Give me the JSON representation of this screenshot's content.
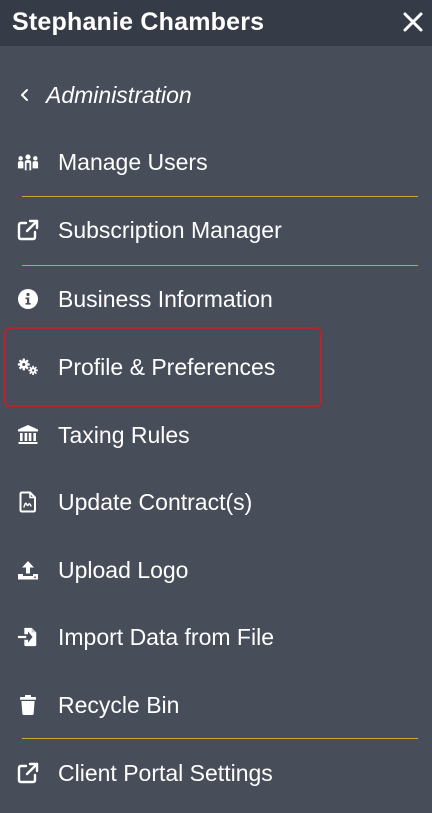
{
  "header": {
    "user_name": "Stephanie Chambers",
    "close_icon": "close-icon"
  },
  "back": {
    "label": "Administration",
    "icon": "chevron-left-icon"
  },
  "menu": [
    {
      "label": "Manage Users",
      "icon": "users-icon"
    },
    {
      "label": "Subscription Manager",
      "icon": "external-link-icon"
    },
    {
      "label": "Business Information",
      "icon": "info-circle-icon"
    },
    {
      "label": "Profile & Preferences",
      "icon": "gears-icon",
      "highlighted": true
    },
    {
      "label": "Taxing Rules",
      "icon": "bank-icon"
    },
    {
      "label": "Update Contract(s)",
      "icon": "file-signature-icon"
    },
    {
      "label": "Upload Logo",
      "icon": "upload-icon"
    },
    {
      "label": "Import Data from File",
      "icon": "file-import-icon"
    },
    {
      "label": "Recycle Bin",
      "icon": "trash-icon"
    },
    {
      "label": "Client Portal Settings",
      "icon": "external-link-icon"
    }
  ],
  "colors": {
    "panel_bg": "#474d59",
    "header_bg": "#363c47",
    "divider": "#c8a92b",
    "highlight_border": "#b3262d",
    "text": "#ffffff"
  }
}
